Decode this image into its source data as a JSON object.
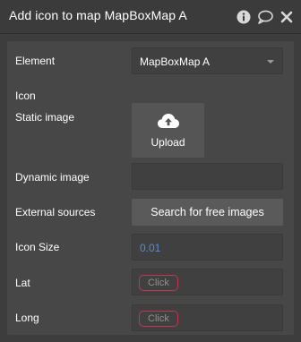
{
  "window": {
    "title": "Add icon to map MapBoxMap A",
    "icons": [
      "info-icon",
      "comment-icon",
      "close-icon"
    ]
  },
  "fields": {
    "element": {
      "label": "Element",
      "value": "MapBoxMap A"
    },
    "icon": {
      "label": "Icon"
    },
    "static_image": {
      "label": "Static image",
      "button_label": "Upload"
    },
    "dynamic_image": {
      "label": "Dynamic image",
      "value": ""
    },
    "external_sources": {
      "label": "External sources",
      "button_label": "Search for free images"
    },
    "icon_size": {
      "label": "Icon Size",
      "value": "0.01"
    },
    "lat": {
      "label": "Lat",
      "chip": "Click"
    },
    "long": {
      "label": "Long",
      "chip": "Click"
    }
  },
  "colors": {
    "panel_bg": "#3d3d3d",
    "body_bg": "#474747",
    "number_accent": "#4f8fd6",
    "chip_border": "#c0384f"
  }
}
